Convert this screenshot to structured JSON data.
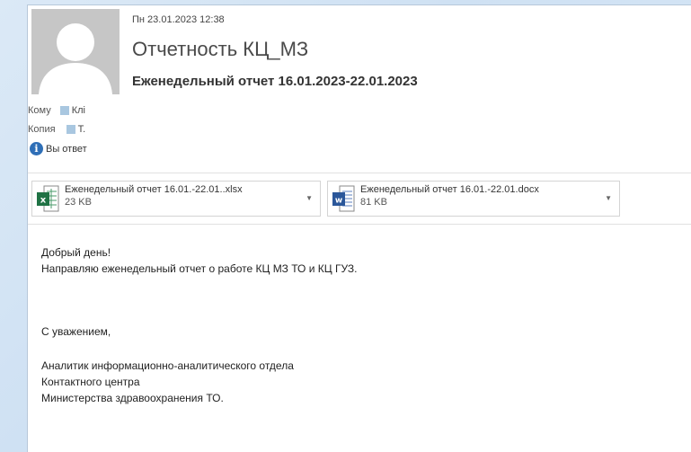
{
  "message": {
    "date": "Пн 23.01.2023 12:38",
    "subject": "Отчетность КЦ_МЗ",
    "heading": "Еженедельный отчет 16.01.2023-22.01.2023"
  },
  "recipients": {
    "to_label": "Кому",
    "to_value": "Клі",
    "cc_label": "Копия",
    "cc_value": "Т.",
    "info_text": "Вы ответ"
  },
  "attachments": [
    {
      "name": "Еженедельный отчет 16.01.-22.01..xlsx",
      "size": "23 KB",
      "type": "excel-icon"
    },
    {
      "name": "Еженедельный отчет 16.01.-22.01.docx",
      "size": "81 KB",
      "type": "word-icon"
    }
  ],
  "body": {
    "greeting": "Добрый день!",
    "line1": "Направляю еженедельный отчет о работе КЦ МЗ ТО и КЦ ГУЗ.",
    "regards": "С уважением,",
    "sig1": "Аналитик информационно-аналитического отдела",
    "sig2": "Контактного центра",
    "sig3": "Министерства здравоохранения ТО."
  },
  "colors": {
    "excel": "#1f7244",
    "word": "#2b579a",
    "info": "#2f6fb7",
    "chip": "#a9c7e0"
  }
}
